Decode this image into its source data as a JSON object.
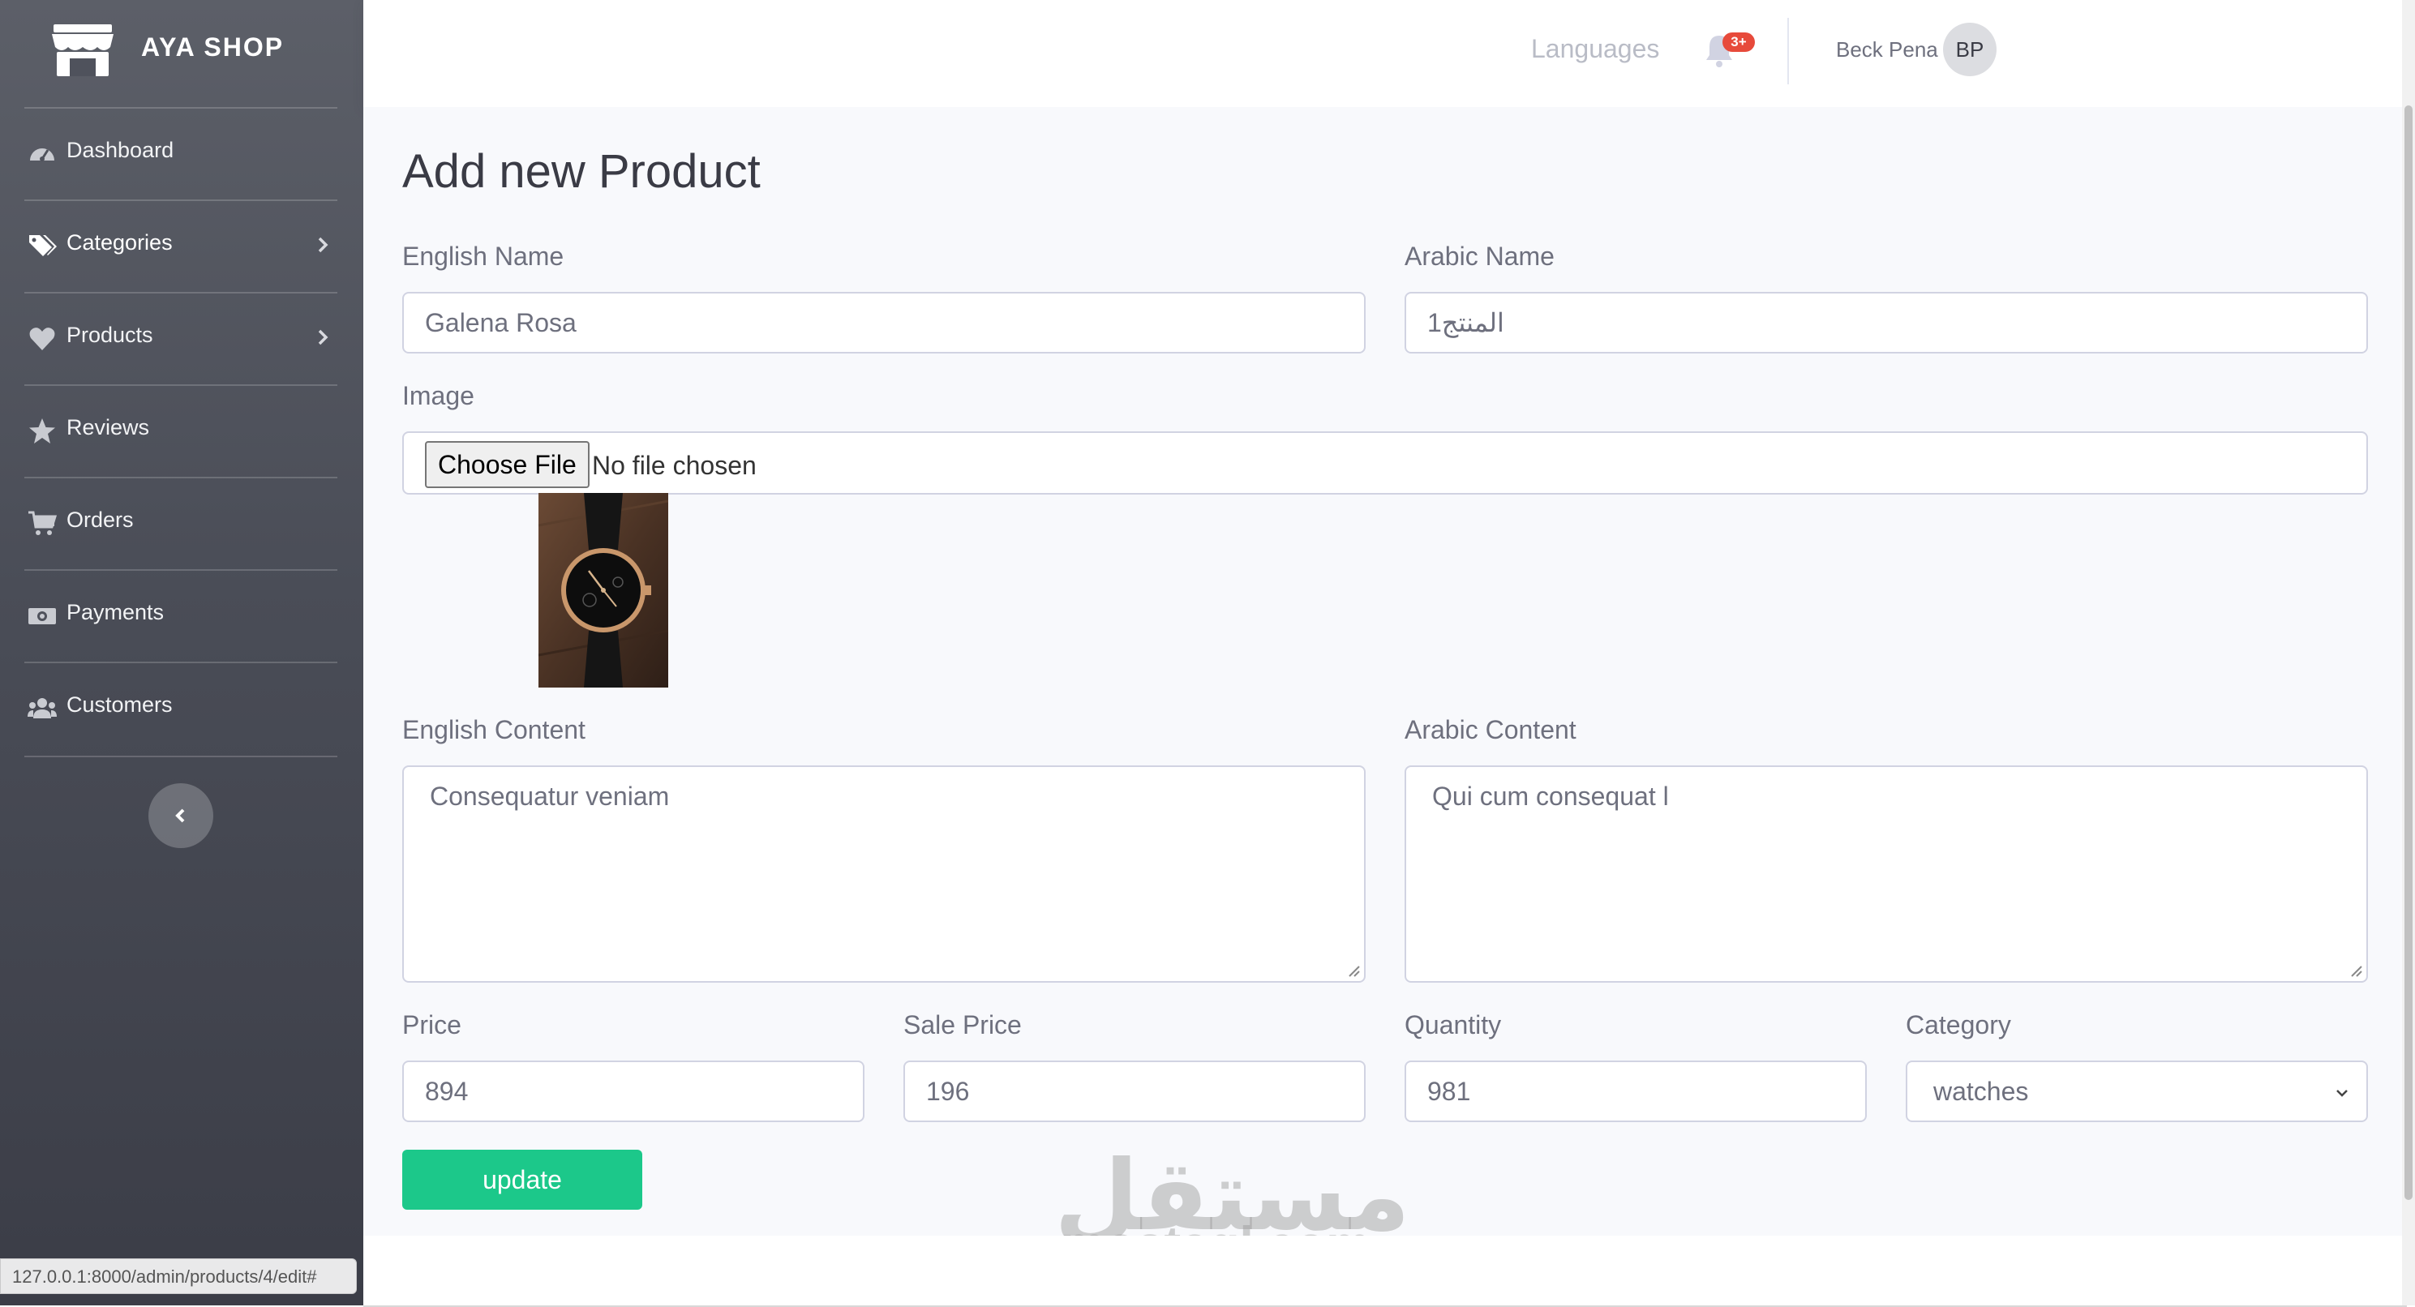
{
  "brand": {
    "name": "AYA SHOP",
    "icon": "store-icon"
  },
  "sidebar": {
    "items": [
      {
        "label": "Dashboard",
        "icon": "tachometer-icon",
        "has_submenu": false
      },
      {
        "label": "Categories",
        "icon": "tags-icon",
        "has_submenu": true
      },
      {
        "label": "Products",
        "icon": "heart-icon",
        "has_submenu": true
      },
      {
        "label": "Reviews",
        "icon": "star-icon",
        "has_submenu": false
      },
      {
        "label": "Orders",
        "icon": "cart-icon",
        "has_submenu": false
      },
      {
        "label": "Payments",
        "icon": "money-bill-icon",
        "has_submenu": false
      },
      {
        "label": "Customers",
        "icon": "users-icon",
        "has_submenu": false
      }
    ],
    "collapse_icon": "chevron-left-icon"
  },
  "topbar": {
    "languages": "Languages",
    "notification_badge": "3+",
    "user_name": "Beck Pena",
    "user_initials": "BP"
  },
  "form": {
    "title": "Add new Product",
    "english_name": {
      "label": "English Name",
      "value": "Galena Rosa"
    },
    "arabic_name": {
      "label": "Arabic Name",
      "value": "المنتج1"
    },
    "image": {
      "label": "Image",
      "button": "Choose File",
      "status": "No file chosen"
    },
    "english_content": {
      "label": "English Content",
      "value": "Consequatur veniam"
    },
    "arabic_content": {
      "label": "Arabic Content",
      "value": "Qui cum consequat l"
    },
    "price": {
      "label": "Price",
      "value": "894"
    },
    "sale_price": {
      "label": "Sale Price",
      "value": "196"
    },
    "quantity": {
      "label": "Quantity",
      "value": "981"
    },
    "category": {
      "label": "Category",
      "value": "watches"
    },
    "submit": "update"
  },
  "status_bar_url": "127.0.0.1:8000/admin/products/4/edit#",
  "watermark": {
    "arabic": "مستقل",
    "latin": "mostaql.com"
  },
  "colors": {
    "accent_green": "#1cc88a",
    "badge_red": "#e74a3b",
    "sidebar_dark": "#3b3d47"
  }
}
